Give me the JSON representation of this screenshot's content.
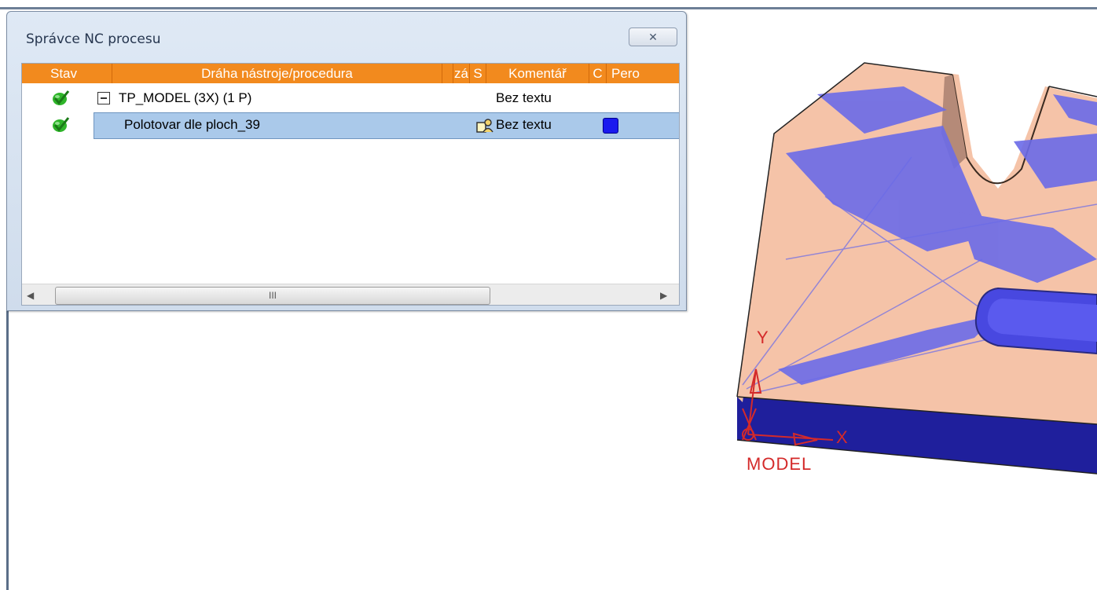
{
  "dialog": {
    "title": "Správce NC procesu",
    "close_icon": "close-x-icon"
  },
  "grid": {
    "columns": [
      "Stav",
      "Dráha nástroje/procedura",
      "",
      "zá",
      "S",
      "Komentář",
      "C",
      "Pero"
    ],
    "rows": [
      {
        "status_icon": "check-icon",
        "tree_toggle_icon": "minus-box-icon",
        "name": "TP_MODEL (3X) (1 P)",
        "comment": "Bez textu"
      },
      {
        "status_icon": "check-icon",
        "name": "Polotovar dle ploch_39",
        "s_icon": "workpiece-person-icon",
        "comment": "Bez textu",
        "color": "#1a1aef"
      }
    ]
  },
  "scrollbar": {
    "thumb_grip": "III",
    "left_icon": "arrow-left-icon",
    "right_icon": "arrow-right-icon"
  },
  "viewport": {
    "axis_y_label": "Y",
    "axis_x_label": "X",
    "csys_label": "MODEL",
    "axis_color": "#d42a2a"
  },
  "colors": {
    "header_orange": "#f28a1e",
    "selection_blue": "#aac9ea",
    "model_face": "#f5c3a8",
    "toolpath_blue": "#6b6be8",
    "model_side": "#1f1f9c"
  }
}
